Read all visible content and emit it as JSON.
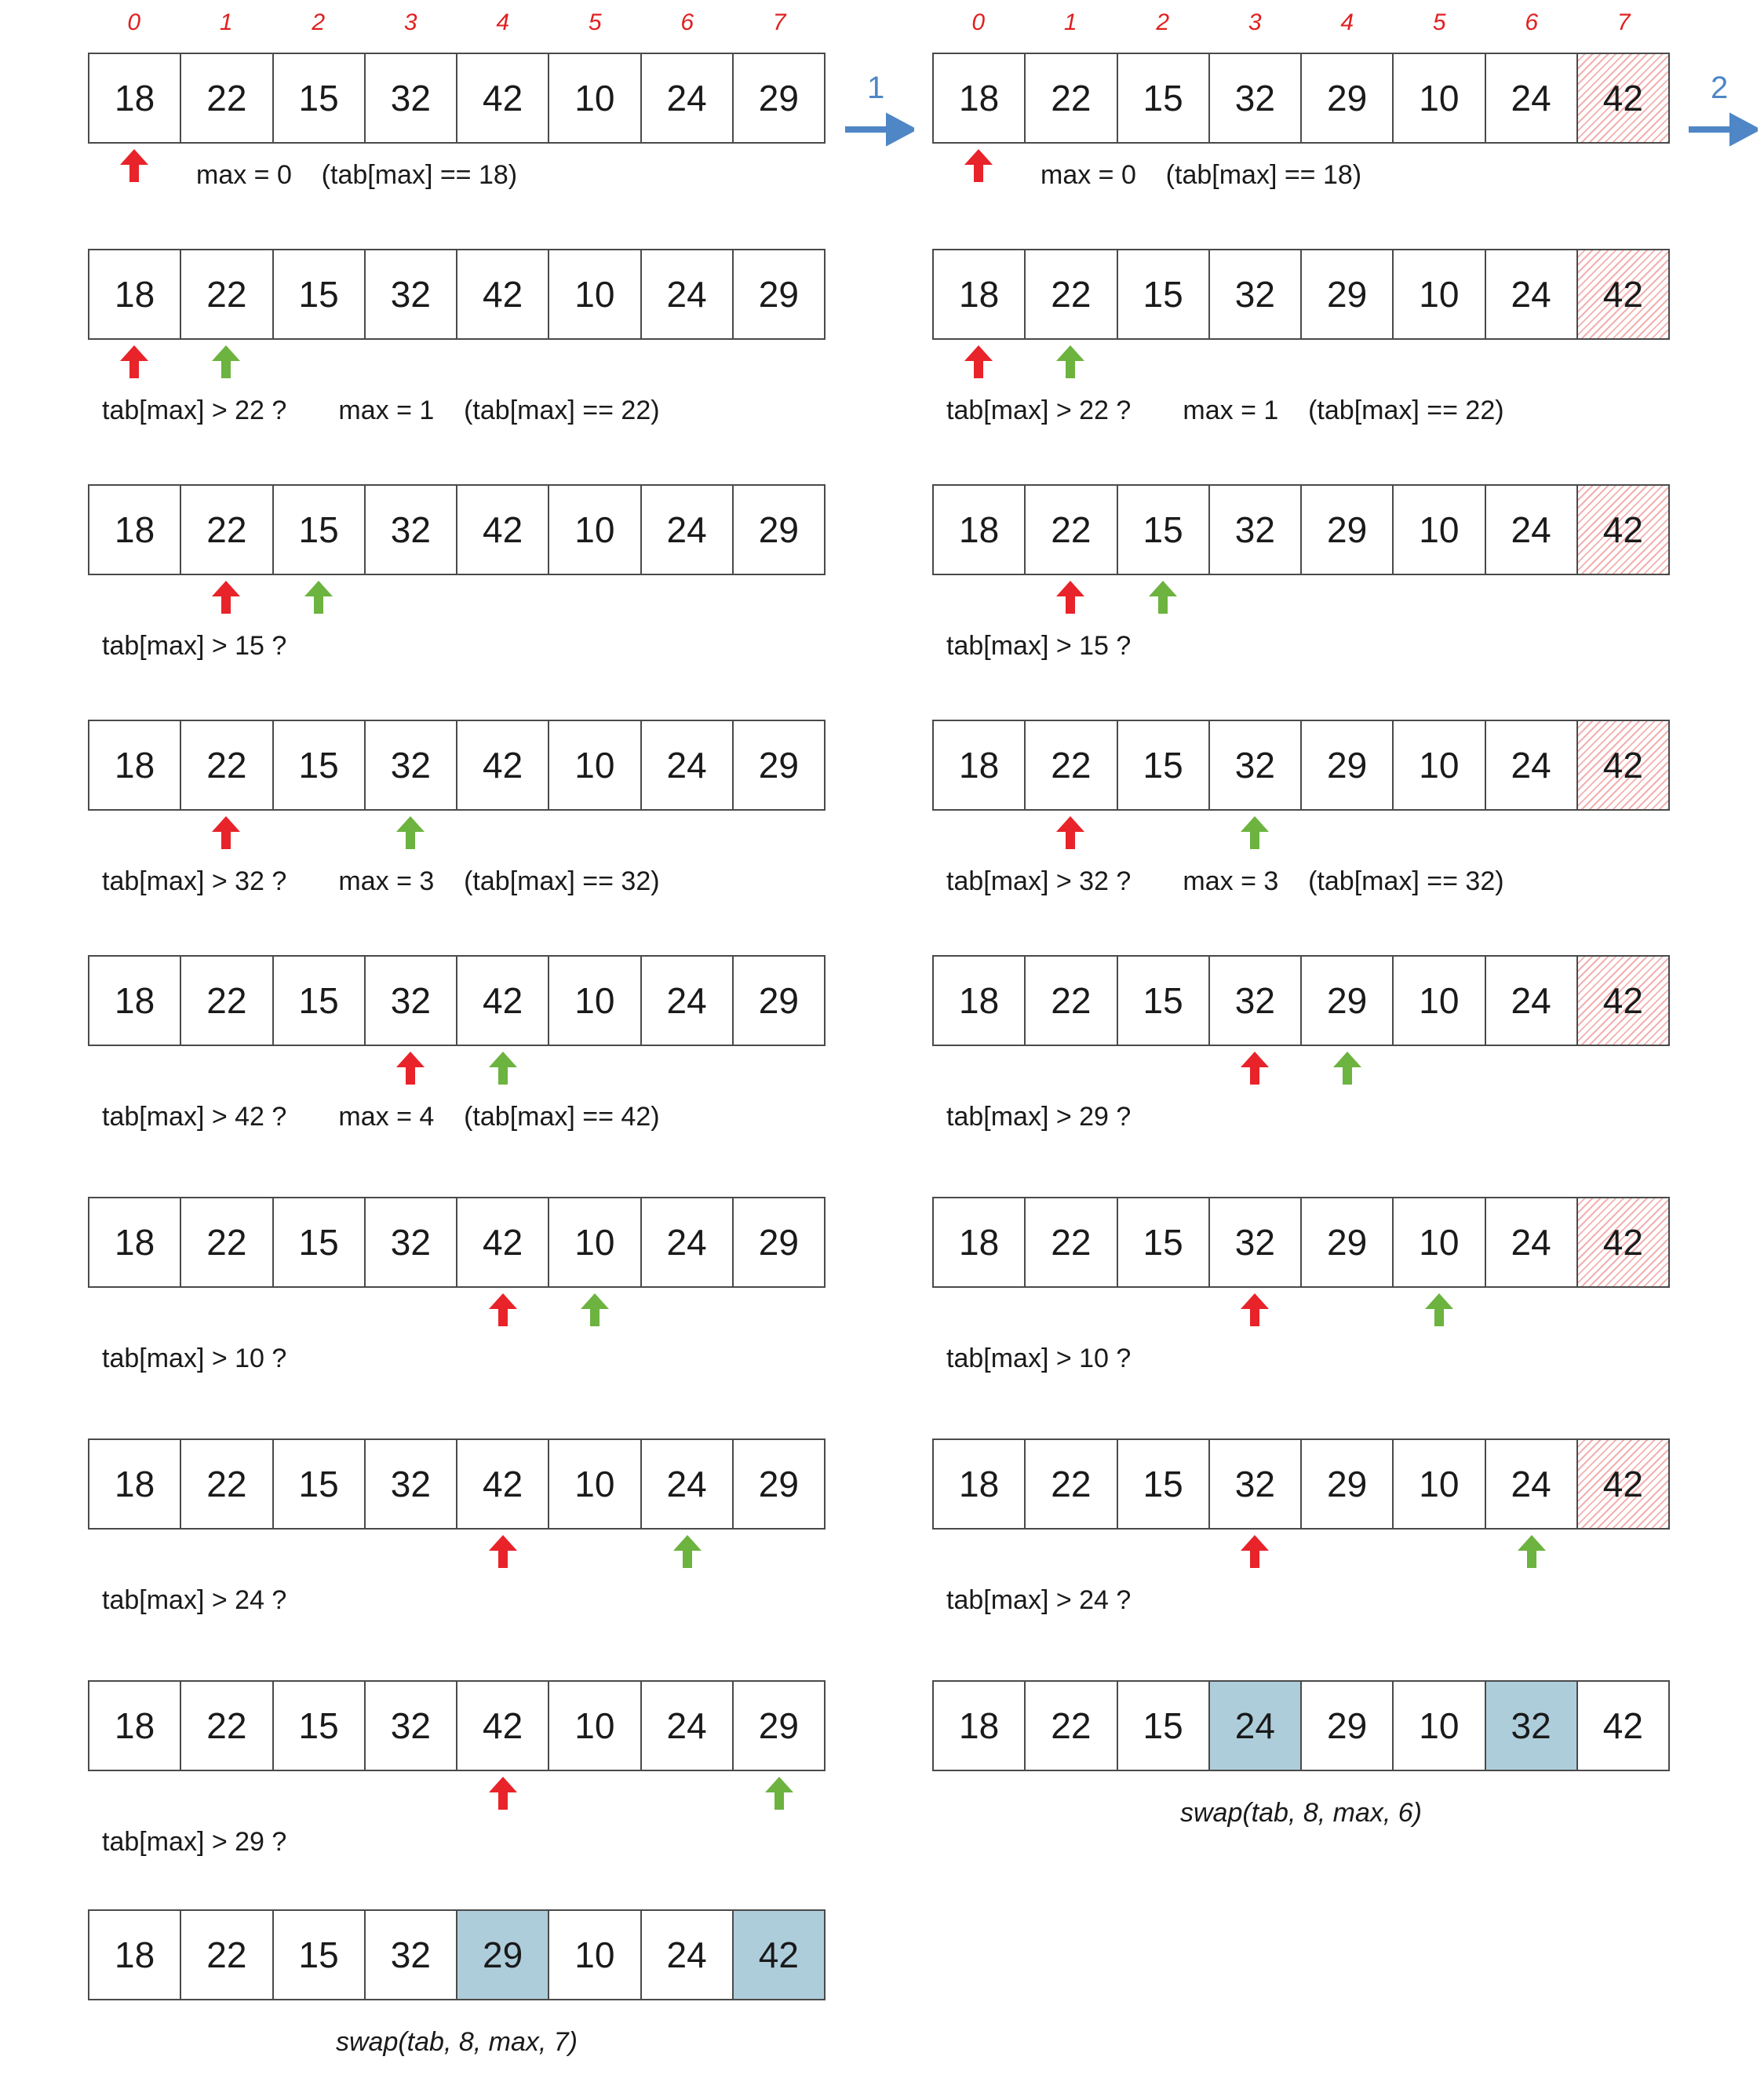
{
  "colors": {
    "current_max_pointer": "#e8232a",
    "scan_pointer": "#6cb33f",
    "index_label": "#e02020",
    "pass_arrow": "#4f86c6",
    "swap_highlight": "#aecddb",
    "sorted_hatch": "#f3b0b0"
  },
  "indices": [
    "0",
    "1",
    "2",
    "3",
    "4",
    "5",
    "6",
    "7"
  ],
  "pass_labels": [
    "1",
    "2"
  ],
  "pass1": {
    "steps": [
      {
        "values": [
          "18",
          "22",
          "15",
          "32",
          "42",
          "10",
          "24",
          "29"
        ],
        "red": 0,
        "green": null,
        "text": "max = 0    (tab[max] == 18)"
      },
      {
        "values": [
          "18",
          "22",
          "15",
          "32",
          "42",
          "10",
          "24",
          "29"
        ],
        "red": 0,
        "green": 1,
        "text": "tab[max] > 22 ?       max = 1    (tab[max] == 22)"
      },
      {
        "values": [
          "18",
          "22",
          "15",
          "32",
          "42",
          "10",
          "24",
          "29"
        ],
        "red": 1,
        "green": 2,
        "text": "tab[max] > 15 ?"
      },
      {
        "values": [
          "18",
          "22",
          "15",
          "32",
          "42",
          "10",
          "24",
          "29"
        ],
        "red": 1,
        "green": 3,
        "text": "tab[max] > 32 ?       max = 3    (tab[max] == 32)"
      },
      {
        "values": [
          "18",
          "22",
          "15",
          "32",
          "42",
          "10",
          "24",
          "29"
        ],
        "red": 3,
        "green": 4,
        "text": "tab[max] > 42 ?       max = 4    (tab[max] == 42)"
      },
      {
        "values": [
          "18",
          "22",
          "15",
          "32",
          "42",
          "10",
          "24",
          "29"
        ],
        "red": 4,
        "green": 5,
        "text": "tab[max] > 10 ?"
      },
      {
        "values": [
          "18",
          "22",
          "15",
          "32",
          "42",
          "10",
          "24",
          "29"
        ],
        "red": 4,
        "green": 6,
        "text": "tab[max] > 24 ?"
      },
      {
        "values": [
          "18",
          "22",
          "15",
          "32",
          "42",
          "10",
          "24",
          "29"
        ],
        "red": 4,
        "green": 7,
        "text": "tab[max] > 29 ?"
      }
    ],
    "result": {
      "values": [
        "18",
        "22",
        "15",
        "32",
        "29",
        "10",
        "24",
        "42"
      ],
      "highlight": [
        4,
        7
      ],
      "caption": "swap(tab, 8, max, 7)"
    }
  },
  "pass2": {
    "steps": [
      {
        "values": [
          "18",
          "22",
          "15",
          "32",
          "29",
          "10",
          "24",
          "42"
        ],
        "red": 0,
        "green": null,
        "text": "max = 0    (tab[max] == 18)"
      },
      {
        "values": [
          "18",
          "22",
          "15",
          "32",
          "29",
          "10",
          "24",
          "42"
        ],
        "red": 0,
        "green": 1,
        "text": "tab[max] > 22 ?       max = 1    (tab[max] == 22)"
      },
      {
        "values": [
          "18",
          "22",
          "15",
          "32",
          "29",
          "10",
          "24",
          "42"
        ],
        "red": 1,
        "green": 2,
        "text": "tab[max] > 15 ?"
      },
      {
        "values": [
          "18",
          "22",
          "15",
          "32",
          "29",
          "10",
          "24",
          "42"
        ],
        "red": 1,
        "green": 3,
        "text": "tab[max] > 32 ?       max = 3    (tab[max] == 32)"
      },
      {
        "values": [
          "18",
          "22",
          "15",
          "32",
          "29",
          "10",
          "24",
          "42"
        ],
        "red": 3,
        "green": 4,
        "text": "tab[max] > 29 ?"
      },
      {
        "values": [
          "18",
          "22",
          "15",
          "32",
          "29",
          "10",
          "24",
          "42"
        ],
        "red": 3,
        "green": 5,
        "text": "tab[max] > 10 ?"
      },
      {
        "values": [
          "18",
          "22",
          "15",
          "32",
          "29",
          "10",
          "24",
          "42"
        ],
        "red": 3,
        "green": 6,
        "text": "tab[max] > 24 ?"
      }
    ],
    "sorted_cell": 7,
    "result": {
      "values": [
        "18",
        "22",
        "15",
        "24",
        "29",
        "10",
        "32",
        "42"
      ],
      "highlight": [
        3,
        6
      ],
      "caption": "swap(tab, 8, max, 6)"
    }
  }
}
